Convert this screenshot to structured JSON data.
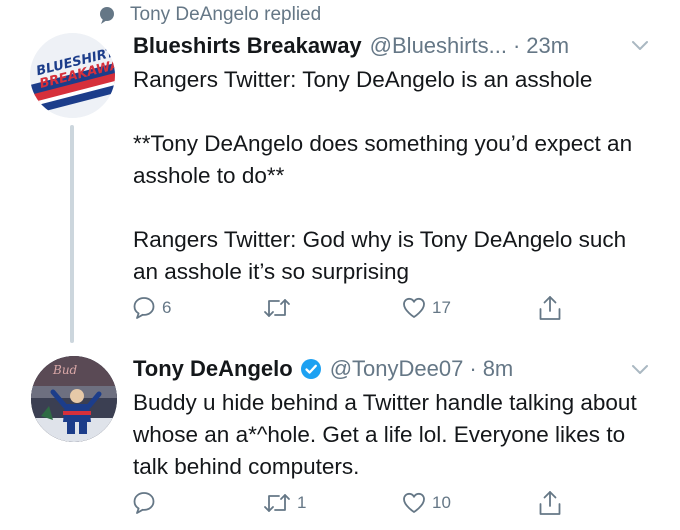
{
  "context": {
    "text": "Tony DeAngelo replied"
  },
  "tweets": [
    {
      "name": "Blueshirts Breakaway",
      "handle": "@Blueshirts...",
      "separator": "·",
      "time": "23m",
      "avatar_text": "BLUESHIRTS BREAKAWAY",
      "body": [
        "Rangers Twitter: Tony DeAngelo is an asshole",
        "**Tony DeAngelo does something you’d expect an asshole to do**",
        "Rangers Twitter: God why is Tony DeAngelo such an asshole it’s so surprising"
      ],
      "actions": {
        "reply_count": "6",
        "retweet_count": "",
        "like_count": "17"
      }
    },
    {
      "name": "Tony DeAngelo",
      "handle": "@TonyDee07",
      "separator": "·",
      "time": "8m",
      "verified": true,
      "body": [
        "Buddy u hide behind a Twitter handle talking about whose an a*^hole. Get a life lol. Everyone likes to talk behind computers."
      ],
      "actions": {
        "reply_count": "",
        "retweet_count": "1",
        "like_count": "10"
      }
    }
  ],
  "colors": {
    "text": "#14171a",
    "secondary": "#657786",
    "verified": "#1da1f2",
    "thread_line": "#ccd6dd"
  },
  "icons": [
    "speech-bubble-icon",
    "chevron-down-icon",
    "reply-icon",
    "retweet-icon",
    "like-icon",
    "share-icon",
    "verified-badge-icon"
  ]
}
